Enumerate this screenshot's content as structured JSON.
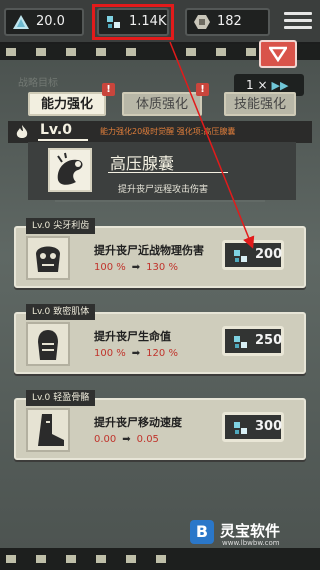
{
  "topbar": {
    "resource_1": {
      "value": "20.0",
      "icon": "triangle-crystal-icon"
    },
    "resource_2": {
      "value": "1.14K",
      "icon": "gene-cells-icon"
    },
    "resource_3": {
      "value": "182",
      "icon": "brain-coin-icon"
    },
    "menu_icon": "hamburger-menu-icon"
  },
  "background_label": "战略目标",
  "speed": {
    "label": "1 ×",
    "arrows": "▶▶"
  },
  "tabs": [
    {
      "label": "能力强化",
      "active": true,
      "alert": "!"
    },
    {
      "label": "体质强化",
      "active": false,
      "alert": "!"
    },
    {
      "label": "技能强化",
      "active": false
    }
  ],
  "level": {
    "label": "Lv.0",
    "description": "能力强化20级时觉醒 强化项:高压腺囊"
  },
  "skill": {
    "name": "高压腺囊",
    "description": "提升丧尸远程攻击伤害"
  },
  "cards": [
    {
      "tag_level": "Lv.0",
      "tag_name": "尖牙利齿",
      "title": "提升丧尸近战物理伤害",
      "value_from": "100 %",
      "value_to": "130 %",
      "cost": "200",
      "icon": "zombie-head-icon"
    },
    {
      "tag_level": "Lv.0",
      "tag_name": "致密肌体",
      "title": "提升丧尸生命值",
      "value_from": "100 %",
      "value_to": "120 %",
      "cost": "250",
      "icon": "zombie-torso-icon"
    },
    {
      "tag_level": "Lv.0",
      "tag_name": "轻盈骨骼",
      "title": "提升丧尸移动速度",
      "value_from": "0.00",
      "value_to": "0.05",
      "cost": "300",
      "icon": "zombie-foot-icon"
    }
  ],
  "colors": {
    "highlight": "#e21b1b",
    "value_red": "#c0342c",
    "level_orange": "#e07e3b",
    "gene_cyan": "#71c7d8"
  },
  "watermark": {
    "name": "灵宝软件",
    "url": "www.lbwbw.com",
    "icon_letter": "B"
  }
}
